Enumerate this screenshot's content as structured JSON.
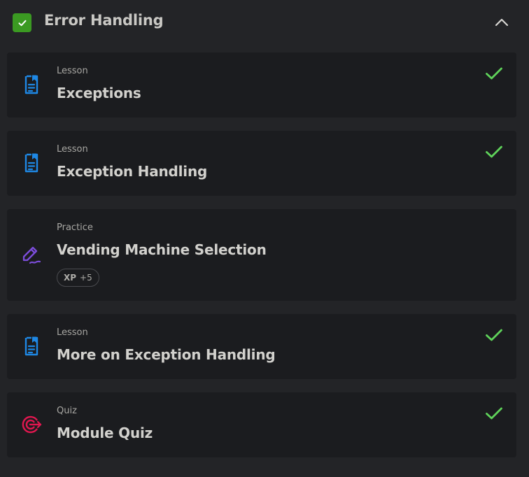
{
  "module": {
    "title": "Error Handling",
    "completed": true,
    "expanded": true,
    "check_color": "#3b9a22"
  },
  "items": [
    {
      "type": "Lesson",
      "title": "Exceptions",
      "icon": "lesson-document-icon",
      "completed": true
    },
    {
      "type": "Lesson",
      "title": "Exception Handling",
      "icon": "lesson-document-icon",
      "completed": true
    },
    {
      "type": "Practice",
      "title": "Vending Machine Selection",
      "icon": "practice-pencil-icon",
      "completed": false,
      "xp": {
        "label": "XP",
        "value": "+5"
      }
    },
    {
      "type": "Lesson",
      "title": "More on Exception Handling",
      "icon": "lesson-document-icon",
      "completed": true
    },
    {
      "type": "Quiz",
      "title": "Module Quiz",
      "icon": "quiz-target-icon",
      "completed": true
    }
  ],
  "colors": {
    "lesson_icon": "#1e88e5",
    "practice_icon": "#7c4ddb",
    "quiz_icon": "#e0174f",
    "done_check": "#5fd35a"
  }
}
